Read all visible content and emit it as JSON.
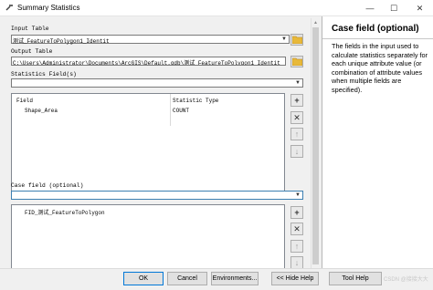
{
  "window": {
    "title": "Summary Statistics",
    "min_glyph": "—",
    "max_glyph": "☐",
    "close_glyph": "✕"
  },
  "form": {
    "input_table": {
      "label": "Input Table",
      "value": "测试_FeatureToPolygon1_Identit"
    },
    "output_table": {
      "label": "Output Table",
      "value": "C:\\Users\\Administrator\\Documents\\ArcGIS\\Default.gdb\\测试_FeatureToPolygon1_Identit"
    },
    "statistics_fields": {
      "label": "Statistics Field(s)",
      "value": "",
      "columns": [
        "Field",
        "Statistic Type"
      ],
      "rows": [
        {
          "field": "Shape_Area",
          "statistic": "COUNT"
        }
      ]
    },
    "case_field": {
      "label": "Case field (optional)",
      "value": "",
      "items": [
        "FID_测试_FeatureToPolygon"
      ]
    }
  },
  "help": {
    "title": "Case field (optional)",
    "body": "The fields in the input used to calculate statistics separately for each unique attribute value (or combination of attribute values when multiple fields are specified)."
  },
  "buttons": {
    "ok": "OK",
    "cancel": "Cancel",
    "environments": "Environments...",
    "hide_help": "<< Hide Help",
    "tool_help": "Tool Help"
  },
  "side_glyphs": {
    "add": "+",
    "remove": "✕",
    "up": "↑",
    "down": "↓"
  },
  "watermark": "CSDN @接接大大",
  "colors": {
    "accent_blue": "#0078d7",
    "field_border": "#3c7fb1"
  }
}
